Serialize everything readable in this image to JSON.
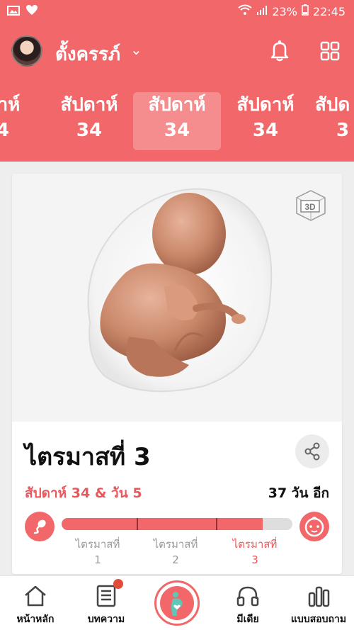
{
  "status_bar": {
    "battery": "23%",
    "time": "22:45"
  },
  "header": {
    "user_name": "ตั้งครรภ์",
    "caret": "⌄"
  },
  "week_tabs": [
    {
      "label": "ดาห์",
      "num": "4"
    },
    {
      "label": "สัปดาห์",
      "num": "34"
    },
    {
      "label": "สัปดาห์",
      "num": "34",
      "active": true
    },
    {
      "label": "สัปดาห์",
      "num": "34"
    },
    {
      "label": "สัปด",
      "num": "3"
    }
  ],
  "card": {
    "badge_3d": "3D",
    "trimester_title": "ไตรมาสที่ 3",
    "week_day_text": "สัปดาห์ 34 & วัน 5",
    "days_left_text": "37 วัน อีก",
    "progress_fraction": 0.87,
    "trimester_labels": [
      {
        "label": "ไตรมาสที่",
        "num": "1"
      },
      {
        "label": "ไตรมาสที่",
        "num": "2"
      },
      {
        "label": "ไตรมาสที่",
        "num": "3"
      }
    ]
  },
  "nav": {
    "home": "หน้าหลัก",
    "articles": "บทความ",
    "media": "มีเดีย",
    "quiz": "แบบสอบถาม"
  },
  "colors": {
    "brand": "#f2676a",
    "accent_text": "#e8585c"
  }
}
